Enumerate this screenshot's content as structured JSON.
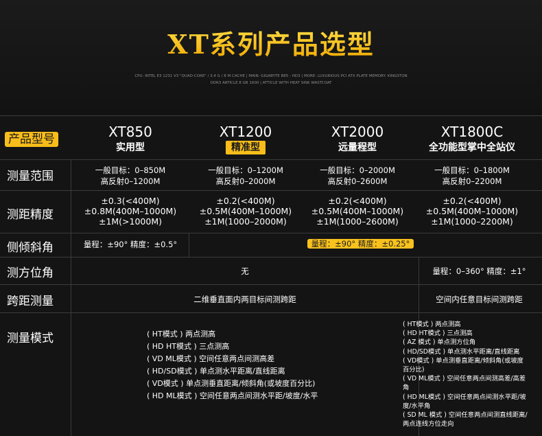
{
  "header": {
    "title": "XT系列产品选型",
    "sub_line1": "CPU: INTEL E3 1231 V3 \"QUAD-CORE\" / 3.4 G / 8 M CACHE | MAIN: GIGABYTE B85 - HD3 | MORE: LUXURIOUS PCI ATX PLATE MEMORY: KINGSTON",
    "sub_line2": "DDR3 ARTICLE 8 GB 1600 | ATTICLE WITH HEAT SINK WASTCOAT"
  },
  "labels": {
    "model": "产品型号",
    "range": "测量范围",
    "accuracy": "测距精度",
    "tilt": "侧倾斜角",
    "azimuth": "测方位角",
    "span": "跨距测量",
    "mode": "测量模式"
  },
  "models": [
    {
      "name": "XT850",
      "type": "实用型"
    },
    {
      "name": "XT1200",
      "type": "精准型"
    },
    {
      "name": "XT2000",
      "type": "远量程型"
    },
    {
      "name": "XT1800C",
      "type": "全功能型掌中全站仪"
    }
  ],
  "range": [
    [
      "一般目标：0–850M",
      "高反射0–1200M"
    ],
    [
      "一般目标：0–1200M",
      "高反射0–2000M"
    ],
    [
      "一般目标：0–2000M",
      "高反射0–2600M"
    ],
    [
      "一般目标：0–1800M",
      "高反射0–2200M"
    ]
  ],
  "accuracy": [
    [
      "±0.3(<400M)",
      "±0.8M(400M–1000M)",
      "±1M(>1000M)"
    ],
    [
      "±0.2(<400M)",
      "±0.5M(400M–1000M)",
      "±1M(1000–2000M)"
    ],
    [
      "±0.2(<400M)",
      "±0.5M(400M–1000M)",
      "±1M(1000–2600M)"
    ],
    [
      "±0.2(<400M)",
      "±0.5M(400M–1000M)",
      "±1M(1000–2200M)"
    ]
  ],
  "tilt": {
    "a": "量程：±90° 精度：±0.5°",
    "b": "量程：±90° 精度：±0.25°"
  },
  "azimuth": {
    "a": "无",
    "b": "量程：0–360° 精度：±1°"
  },
  "span": {
    "a": "二维垂直面内两目标间测跨距",
    "b": "空间内任意目标间测跨距"
  },
  "modes_a": [
    "( HT模式 ) 两点测高",
    "( HD HT模式 ) 三点测高",
    "( VD ML模式 ) 空间任意两点间测高差",
    "( HD/SD模式 ) 单点测水平距离/直线距离",
    "( VD模式 ) 单点测垂直距离/倾斜角(或坡度百分比)",
    "( HD ML模式 ) 空间任意两点间测水平距/坡度/水平"
  ],
  "modes_b": [
    "( HT模式 ) 两点测高",
    "( HD HT模式 ) 三点测高",
    "( AZ 模式 ) 单点测方位角",
    "( HD/SD模式 ) 单点测水平距离/直线距离",
    "( VD模式 ) 单点测垂直距离/倾斜角(或坡度",
    "百分比)",
    "( VD ML模式 ) 空间任意两点间测高差/高差",
    "角",
    "( HD ML模式 ) 空间任意两点间测水平距/坡",
    "度/水平角",
    "( SD ML 模式 ) 空间任意两点间测直线距离/",
    "两点连线方位走向"
  ]
}
